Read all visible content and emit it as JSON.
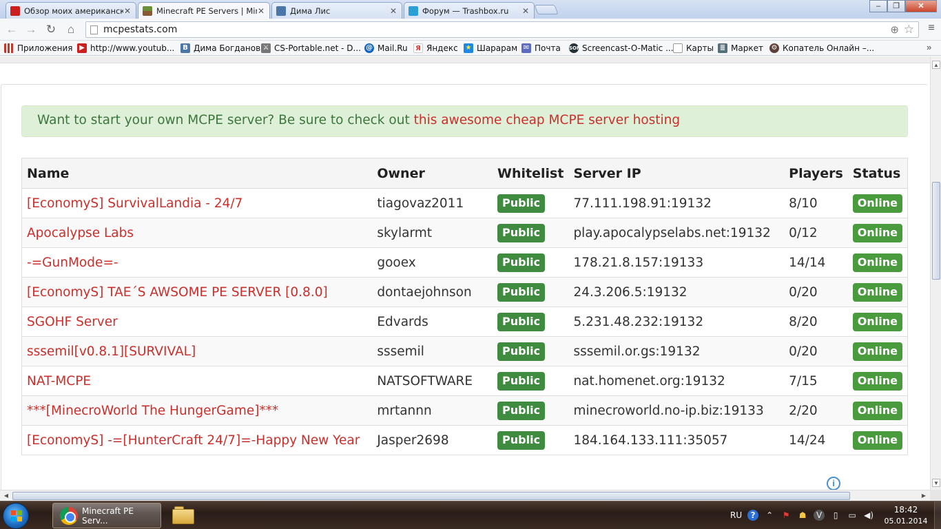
{
  "browser": {
    "tabs": [
      {
        "title": "Обзор моих американск",
        "close": "✕",
        "icon_color": "#cc1f1f",
        "active": false
      },
      {
        "title": "Minecraft PE Servers | Min",
        "close": "✕",
        "icon_color": "#6b8e3a",
        "active": true
      },
      {
        "title": "Дима Лис",
        "close": "✕",
        "icon_color": "#4a76a8",
        "active": false
      },
      {
        "title": "Форум — Trashbox.ru",
        "close": "✕",
        "icon_color": "#2a9fd6",
        "active": false
      }
    ],
    "address": "mcpestats.com",
    "window_controls": {
      "minimize": "‒",
      "maximize": "❐",
      "close": "✕"
    }
  },
  "bookmarks": [
    {
      "label": "Приложения",
      "icon": "apps-icon",
      "color": "#c0392b"
    },
    {
      "label": "http://www.youtub...",
      "icon": "youtube-icon",
      "color": "#cc1f1f"
    },
    {
      "label": "Дима Богданов",
      "icon": "vk-icon",
      "color": "#4a76a8"
    },
    {
      "label": "CS-Portable.net - D...",
      "icon": "cs-icon",
      "color": "#555555"
    },
    {
      "label": "Mail.Ru",
      "icon": "mailru-icon",
      "color": "#1565c0"
    },
    {
      "label": "Яндекс",
      "icon": "yandex-icon",
      "color": "#e53935"
    },
    {
      "label": "Шарарам",
      "icon": "shararam-icon",
      "color": "#1e88e5"
    },
    {
      "label": "Почта",
      "icon": "mail-icon",
      "color": "#5c6bc0"
    },
    {
      "label": "Screencast-O-Matic ...",
      "icon": "screencast-icon",
      "color": "#263238"
    },
    {
      "label": "Карты",
      "icon": "page-icon",
      "color": "#9e9e9e"
    },
    {
      "label": "Маркет",
      "icon": "market-icon",
      "color": "#546e7a"
    },
    {
      "label": "Копатель Онлайн –...",
      "icon": "kopatel-icon",
      "color": "#5d4037"
    }
  ],
  "bookmarks_more": "»",
  "page": {
    "alert": {
      "text": "Want to start your own MCPE server? Be sure to check out ",
      "link": "this awesome cheap MCPE server hosting"
    },
    "table": {
      "headers": [
        "Name",
        "Owner",
        "Whitelist",
        "Server IP",
        "Players",
        "Status"
      ],
      "rows": [
        {
          "name": "[EconomyS] SurvivalLandia - 24/7",
          "owner": "tiagovaz2011",
          "whitelist": "Public",
          "ip": "77.111.198.91:19132",
          "players": "8/10",
          "status": "Online"
        },
        {
          "name": "Apocalypse Labs",
          "owner": "skylarmt",
          "whitelist": "Public",
          "ip": "play.apocalypselabs.net:19132",
          "players": "0/12",
          "status": "Online"
        },
        {
          "name": "-=GunMode=-",
          "owner": "gooex",
          "whitelist": "Public",
          "ip": "178.21.8.157:19133",
          "players": "14/14",
          "status": "Online"
        },
        {
          "name": "[EconomyS] TAE´S AWSOME PE SERVER [0.8.0]",
          "owner": "dontaejohnson",
          "whitelist": "Public",
          "ip": "24.3.206.5:19132",
          "players": "0/20",
          "status": "Online"
        },
        {
          "name": "SGOHF Server",
          "owner": "Edvards",
          "whitelist": "Public",
          "ip": "5.231.48.232:19132",
          "players": "8/20",
          "status": "Online"
        },
        {
          "name": "sssemil[v0.8.1][SURVIVAL]",
          "owner": "sssemil",
          "whitelist": "Public",
          "ip": "sssemil.or.gs:19132",
          "players": "0/20",
          "status": "Online"
        },
        {
          "name": "NAT-MCPE",
          "owner": "NATSOFTWARE",
          "whitelist": "Public",
          "ip": "nat.homenet.org:19132",
          "players": "7/15",
          "status": "Online"
        },
        {
          "name": "***[MinecroWorld The HungerGame]***",
          "owner": "mrtannn",
          "whitelist": "Public",
          "ip": "minecroworld.no-ip.biz:19133",
          "players": "2/20",
          "status": "Online"
        },
        {
          "name": "[EconomyS] -=[HunterCraft 24/7]=-Happy New Year",
          "owner": "Jasper2698",
          "whitelist": "Public",
          "ip": "184.164.133.111:35057",
          "players": "14/24",
          "status": "Online"
        }
      ]
    },
    "ad_info": "i"
  },
  "taskbar": {
    "chrome_task": "Minecraft PE Serv...",
    "language": "RU",
    "time": "18:42",
    "date": "05.01.2014"
  },
  "colors": {
    "link_red": "#c9302c",
    "alert_green": "#3c763d",
    "alert_bg": "#dff0d8",
    "badge_green": "#3f8b3f"
  }
}
